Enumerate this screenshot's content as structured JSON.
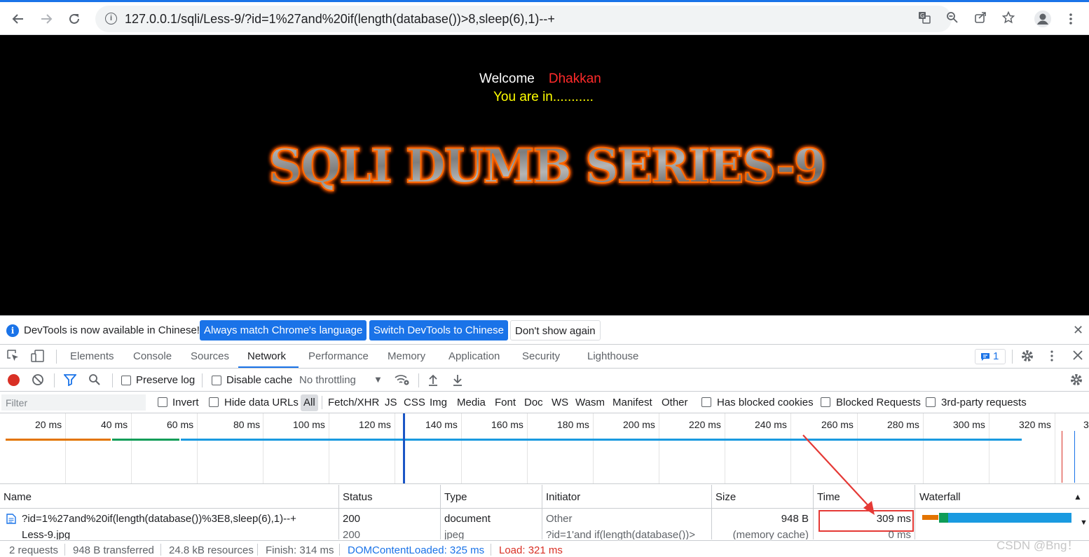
{
  "browser": {
    "url": "127.0.0.1/sqli/Less-9/?id=1%27and%20if(length(database())>8,sleep(6),1)--+",
    "icons": [
      "back-icon",
      "forward-icon",
      "reload-icon",
      "info-icon",
      "translate-icon",
      "zoom-icon",
      "share-icon",
      "bookmark-star-icon",
      "profile-icon",
      "menu-icon"
    ]
  },
  "page": {
    "welcome": "Welcome",
    "name": "Dhakkan",
    "status": "You are in...........",
    "banner": "SQLI DUMB SERIES-9"
  },
  "devtools": {
    "infobar": {
      "message": "DevTools is now available in Chinese!",
      "btn_match": "Always match Chrome's language",
      "btn_switch": "Switch DevTools to Chinese",
      "btn_dismiss": "Don't show again",
      "close": "✕"
    },
    "tabs": [
      "Elements",
      "Console",
      "Sources",
      "Network",
      "Performance",
      "Memory",
      "Application",
      "Security",
      "Lighthouse"
    ],
    "active_tab": "Network",
    "issues_count": "1",
    "network_toolbar": {
      "preserve_log": "Preserve log",
      "disable_cache": "Disable cache",
      "throttling": "No throttling"
    },
    "filter": {
      "placeholder": "Filter",
      "invert": "Invert",
      "hide_data_urls": "Hide data URLs",
      "types": [
        "All",
        "Fetch/XHR",
        "JS",
        "CSS",
        "Img",
        "Media",
        "Font",
        "Doc",
        "WS",
        "Wasm",
        "Manifest",
        "Other"
      ],
      "has_blocked_cookies": "Has blocked cookies",
      "blocked_requests": "Blocked Requests",
      "third_party": "3rd-party requests"
    },
    "overview_ticks": [
      "20 ms",
      "40 ms",
      "60 ms",
      "80 ms",
      "100 ms",
      "120 ms",
      "140 ms",
      "160 ms",
      "180 ms",
      "200 ms",
      "220 ms",
      "240 ms",
      "260 ms",
      "280 ms",
      "300 ms",
      "320 ms",
      "3"
    ],
    "table": {
      "columns": [
        "Name",
        "Status",
        "Type",
        "Initiator",
        "Size",
        "Time",
        "Waterfall"
      ],
      "rows": [
        {
          "name": "?id=1%27and%20if(length(database())%3E8,sleep(6),1)--+",
          "status": "200",
          "type": "document",
          "initiator": "Other",
          "size": "948 B",
          "time": "309 ms"
        },
        {
          "name": "Less-9.jpg",
          "status": "200",
          "type": "jpeg",
          "initiator": "?id=1'and if(length(database())>",
          "size": "(memory cache)",
          "time": "0 ms"
        }
      ]
    },
    "status": {
      "requests": "2 requests",
      "transferred": "948 B transferred",
      "resources": "24.8 kB resources",
      "finish": "Finish: 314 ms",
      "dom_content_loaded": "DOMContentLoaded: 325 ms",
      "load": "Load: 321 ms"
    },
    "colors": {
      "accent": "#1a73e8",
      "record": "#d93025",
      "dcl": "#1a73e8",
      "load": "#d93025",
      "highlight": "#e53935"
    }
  },
  "watermark": "CSDN @Bng！"
}
